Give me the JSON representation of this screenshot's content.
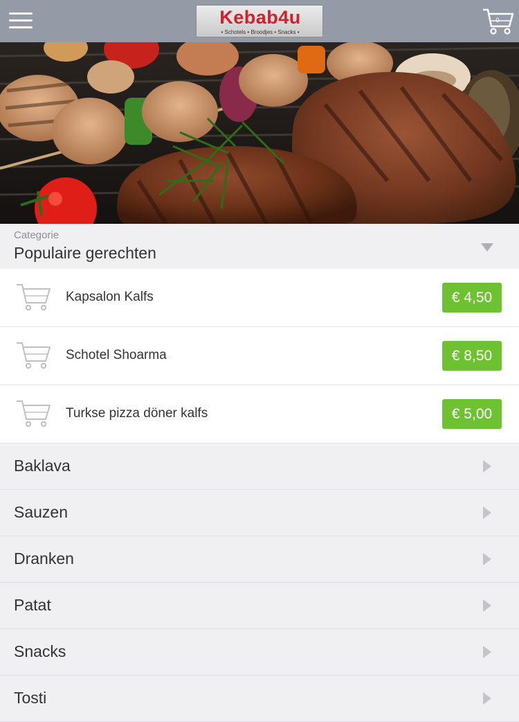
{
  "header": {
    "logo_title": "Kebab4u",
    "logo_subtitle": "• Schotels • Broodjes • Snacks •",
    "cart_count": "0",
    "menu_icon": "hamburger-menu-icon",
    "cart_icon": "shopping-cart-icon",
    "bar_color": "#949ba6"
  },
  "category": {
    "caption": "Categorie",
    "selected": "Populaire gerechten"
  },
  "items": [
    {
      "name": "Kapsalon Kalfs",
      "price": "€ 4,50"
    },
    {
      "name": "Schotel Shoarma",
      "price": "€ 8,50"
    },
    {
      "name": "Turkse pizza döner kalfs",
      "price": "€ 5,00"
    }
  ],
  "categories": [
    {
      "label": "Baklava"
    },
    {
      "label": "Sauzen"
    },
    {
      "label": "Dranken"
    },
    {
      "label": "Patat"
    },
    {
      "label": "Snacks"
    },
    {
      "label": "Tosti"
    }
  ],
  "colors": {
    "price_green": "#6ec231",
    "logo_red": "#d4202a"
  }
}
